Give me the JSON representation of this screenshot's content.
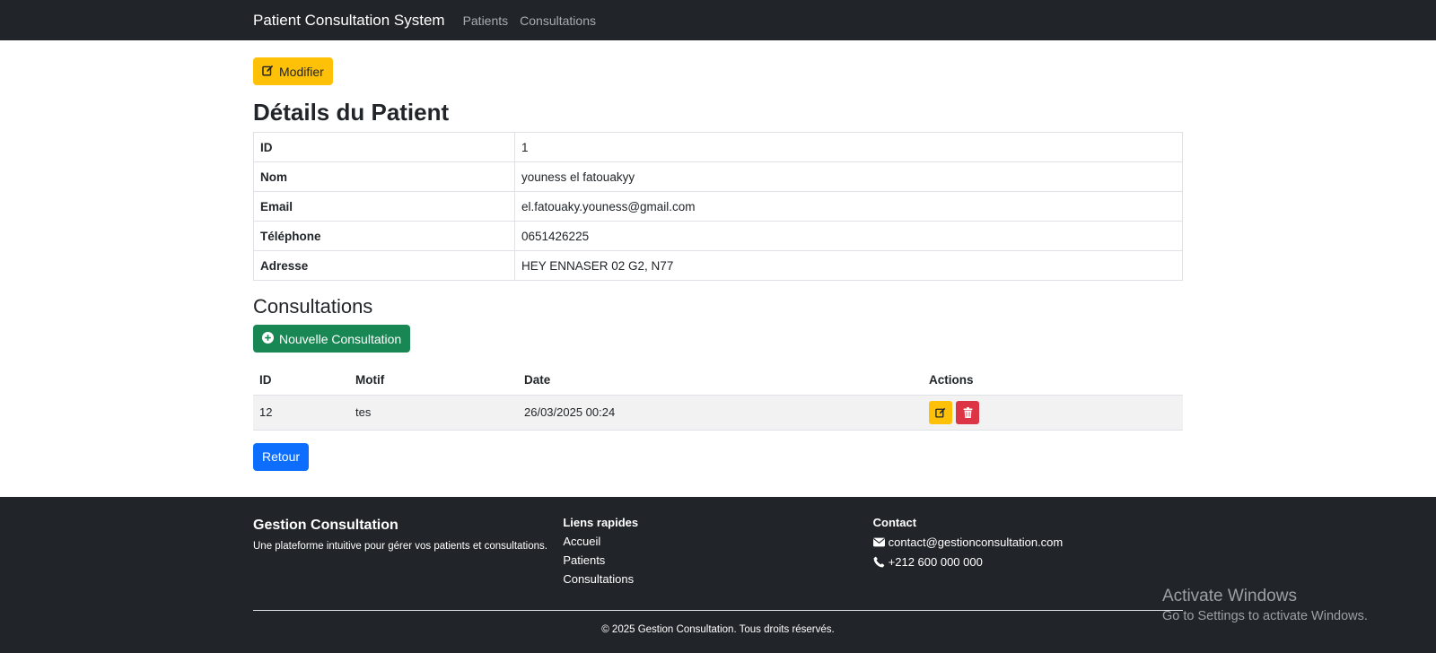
{
  "navbar": {
    "brand": "Patient Consultation System",
    "links": [
      "Patients",
      "Consultations"
    ]
  },
  "actions": {
    "edit_label": "Modifier",
    "new_consultation_label": "Nouvelle Consultation",
    "back_label": "Retour"
  },
  "patient": {
    "title": "Détails du Patient",
    "rows": [
      {
        "label": "ID",
        "value": "1"
      },
      {
        "label": "Nom",
        "value": "youness el fatouakyy"
      },
      {
        "label": "Email",
        "value": "el.fatouaky.youness@gmail.com"
      },
      {
        "label": "Téléphone",
        "value": "0651426225"
      },
      {
        "label": "Adresse",
        "value": "HEY ENNASER 02 G2, N77"
      }
    ]
  },
  "consultations": {
    "title": "Consultations",
    "columns": [
      "ID",
      "Motif",
      "Date",
      "Actions"
    ],
    "rows": [
      {
        "id": "12",
        "motif": "tes",
        "date": "26/03/2025 00:24"
      }
    ]
  },
  "footer": {
    "brand": "Gestion Consultation",
    "description": "Une plateforme intuitive pour gérer vos patients et consultations.",
    "links_title": "Liens rapides",
    "links": [
      "Accueil",
      "Patients",
      "Consultations"
    ],
    "contact_title": "Contact",
    "email": "contact@gestionconsultation.com",
    "phone": "+212 600 000 000",
    "copyright": "© 2025 Gestion Consultation. Tous droits réservés."
  },
  "watermark": {
    "title": "Activate Windows",
    "subtitle": "Go to Settings to activate Windows."
  },
  "colors": {
    "navbar_bg": "#212529",
    "warning": "#ffc107",
    "success": "#198754",
    "danger": "#dc3545",
    "primary": "#0d6efd"
  },
  "icons": {
    "edit": "pencil-square-icon",
    "add": "plus-circle-icon",
    "delete": "trash-icon",
    "email": "envelope-icon",
    "phone": "telephone-icon"
  }
}
